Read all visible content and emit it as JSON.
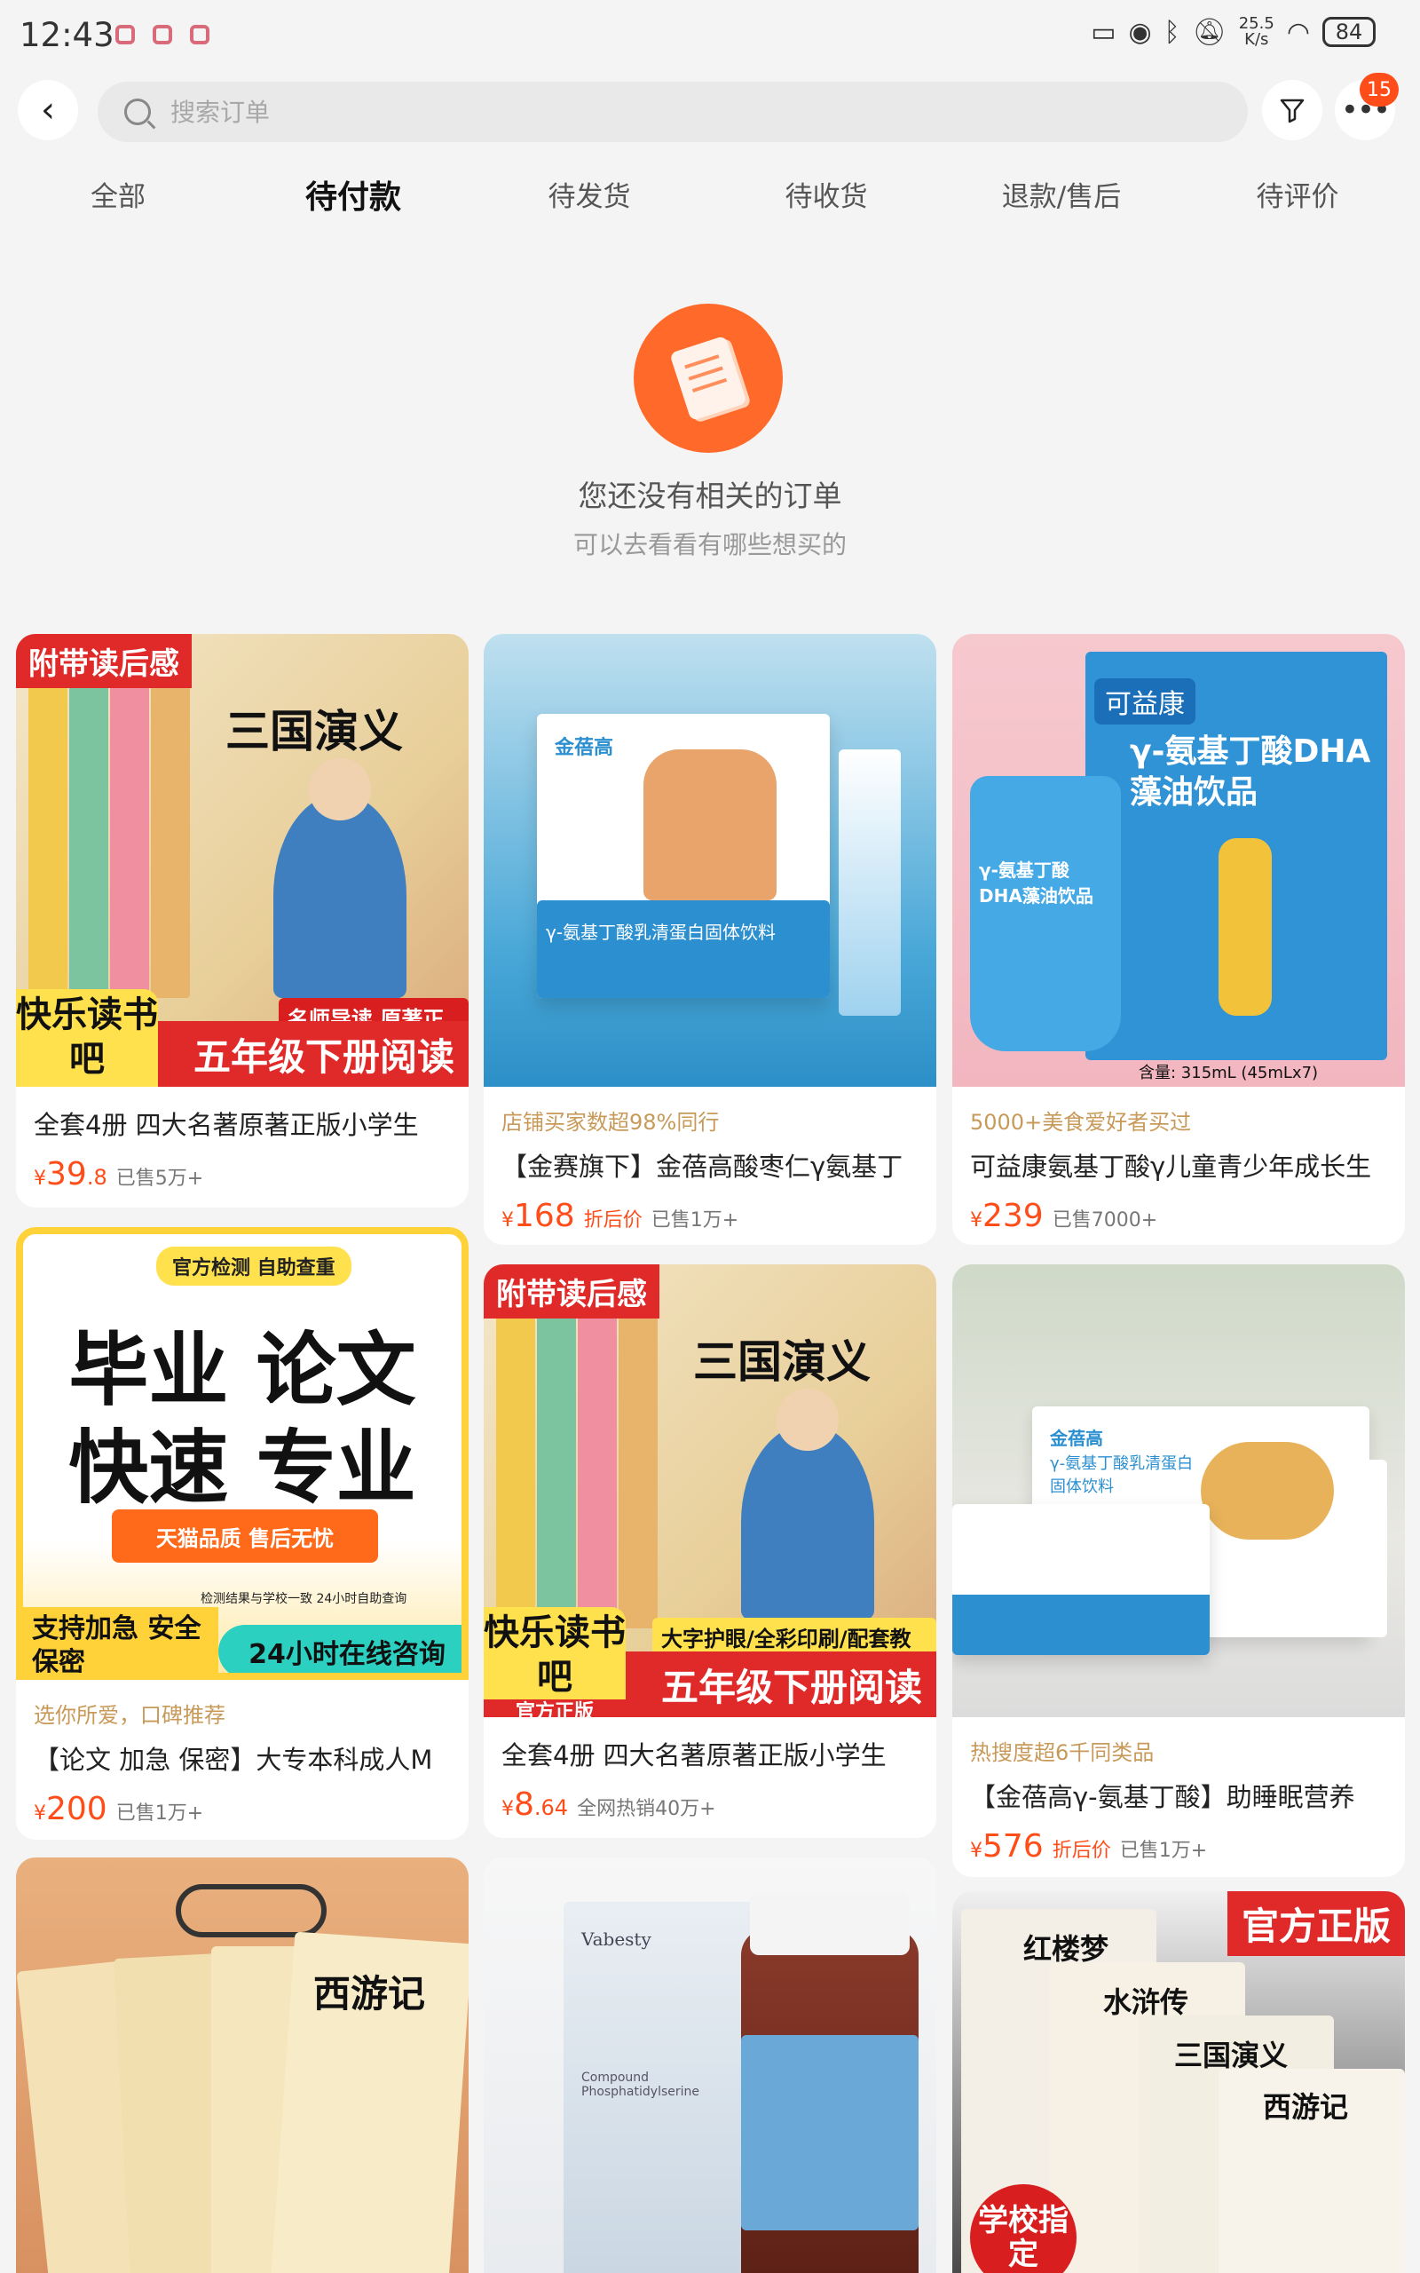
{
  "status_bar": {
    "time": "12:43",
    "speed_value": "25.5",
    "speed_unit": "K/s",
    "battery": "84"
  },
  "header": {
    "search_placeholder": "搜索订单",
    "notification_count": "15"
  },
  "tabs": [
    {
      "label": "全部",
      "active": false
    },
    {
      "label": "待付款",
      "active": true
    },
    {
      "label": "待发货",
      "active": false
    },
    {
      "label": "待收货",
      "active": false
    },
    {
      "label": "退款/售后",
      "active": false
    },
    {
      "label": "待评价",
      "active": false
    }
  ],
  "empty_state": {
    "title": "您还没有相关的订单",
    "subtitle": "可以去看看有哪些想买的"
  },
  "products": [
    {
      "tagline": "",
      "title": "全套4册 四大名著原著正版小学生",
      "price_int": "39",
      "price_dec": ".8",
      "discount": "",
      "sold": "已售5万+",
      "art": {
        "banner": "附带读后感",
        "book_title": "三国演义",
        "box_text": "快乐读书吧",
        "red_tag": "名师导读 原著正版",
        "bottom_text": "五年级下册阅读"
      }
    },
    {
      "tagline": "店铺买家数超98%同行",
      "title": "【金赛旗下】金蓓高酸枣仁γ氨基丁",
      "price_int": "168",
      "price_dec": "",
      "discount": "折后价",
      "sold": "已售1万+",
      "art": {
        "brand": "金蓓高",
        "box_text": "γ-氨基丁酸乳清蛋白固体饮料"
      }
    },
    {
      "tagline": "5000+美食爱好者买过",
      "title": "可益康氨基丁酸γ儿童青少年成长生",
      "price_int": "239",
      "price_dec": "",
      "discount": "",
      "sold": "已售7000+",
      "art": {
        "brand": "可益康",
        "box_text": "γ-氨基丁酸DHA藻油饮品",
        "pouch_text": "γ-氨基丁酸DHA藻油饮品",
        "spec": "含量: 315mL (45mLx7)"
      }
    },
    {
      "tagline": "选你所爱，口碑推荐",
      "title": "【论文 加急 保密】大专本科成人M",
      "price_int": "200",
      "price_dec": "",
      "discount": "",
      "sold": "已售1万+",
      "art": {
        "top_badge": "官方检测 自助查重",
        "line1": "毕业 论文",
        "line2": "快速 专业",
        "ribbon": "天猫品质 售后无忧",
        "left_box": "支持加急 安全保密",
        "right_box": "24小时在线咨询",
        "small_note": "检测结果与学校一致 24小时自助查询"
      }
    },
    {
      "tagline": "",
      "title": "全套4册 四大名著原著正版小学生",
      "price_int": "8",
      "price_dec": ".64",
      "discount": "",
      "sold": "全网热销40万+",
      "art": {
        "banner": "附带读后感",
        "book_title": "三国演义",
        "box_text": "快乐读书吧",
        "box_sub": "官方正版",
        "red_tag": "大字护眼/全彩印刷/配套教材",
        "bottom_text": "五年级下册阅读"
      }
    },
    {
      "tagline": "热搜度超6千同类品",
      "title": "【金蓓高γ-氨基丁酸】助睡眠营养",
      "price_int": "576",
      "price_dec": "",
      "discount": "折后价",
      "sold": "已售1万+",
      "art": {
        "brand": "金蓓高",
        "box_text": "γ-氨基丁酸乳清蛋白固体饮料"
      }
    },
    {
      "art": {
        "book_title": "西游记"
      }
    },
    {
      "art": {
        "brand": "Vabesty",
        "label": "Compound Phosphatidylserine"
      }
    },
    {
      "art": {
        "banner": "官方正版",
        "titles": [
          "红楼梦",
          "水浒传",
          "三国演义",
          "西游记"
        ],
        "badge": "学校指定"
      }
    }
  ]
}
